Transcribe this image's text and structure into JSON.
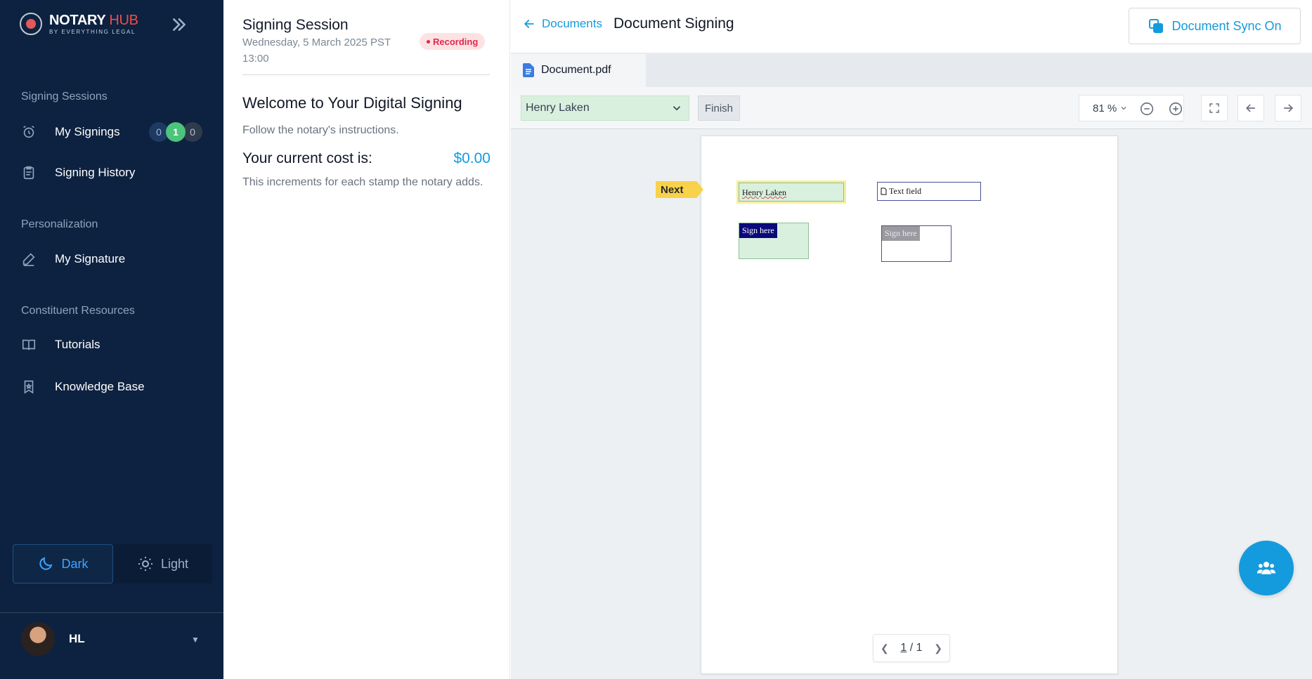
{
  "app": {
    "logo_title": "NOTARY",
    "logo_title_accent": "HUB",
    "logo_subtitle": "BY EVERYTHING LEGAL"
  },
  "sidebar": {
    "sections": {
      "signing": "Signing Sessions",
      "personalization": "Personalization",
      "resources": "Constituent Resources"
    },
    "items": [
      {
        "label": "My Signings",
        "icon": "alarm-clock-icon"
      },
      {
        "label": "Signing History",
        "icon": "clipboard-icon"
      },
      {
        "label": "My Signature",
        "icon": "pen-icon"
      },
      {
        "label": "Tutorials",
        "icon": "book-icon"
      },
      {
        "label": "Knowledge Base",
        "icon": "bookmark-icon"
      }
    ],
    "signing_counts": {
      "pending": "0",
      "active": "1",
      "other": "0"
    },
    "theme": {
      "dark_label": "Dark",
      "light_label": "Light",
      "selected": "Dark"
    },
    "user": {
      "initials": "HL"
    }
  },
  "session": {
    "title": "Signing Session",
    "date": "Wednesday, 5 March 2025   PST 13:00",
    "recording_label": "Recording",
    "welcome": "Welcome to Your Digital Signing",
    "instructions": "Follow the notary's instructions.",
    "cost_label": "Your current cost is:",
    "cost_value": "$0.00",
    "cost_note": "This increments for each stamp the notary adds."
  },
  "viewer": {
    "back_label": "Documents",
    "title": "Document Signing",
    "sync_label": "Document Sync On",
    "tab_label": "Document.pdf",
    "signer_selected": "Henry Laken",
    "finish_label": "Finish",
    "zoom": "81 %",
    "next_label": "Next",
    "fields": {
      "name_value": "Henry Laken",
      "text_placeholder": "Text field",
      "sign_label_1": "Sign here",
      "sign_label_2": "Sign here"
    },
    "page_current": "1",
    "page_total": "1",
    "colors": {
      "accent": "#149bdd",
      "sidebar": "#0d2240",
      "active_green": "#4cc47a",
      "recording": "#e0284a"
    }
  }
}
